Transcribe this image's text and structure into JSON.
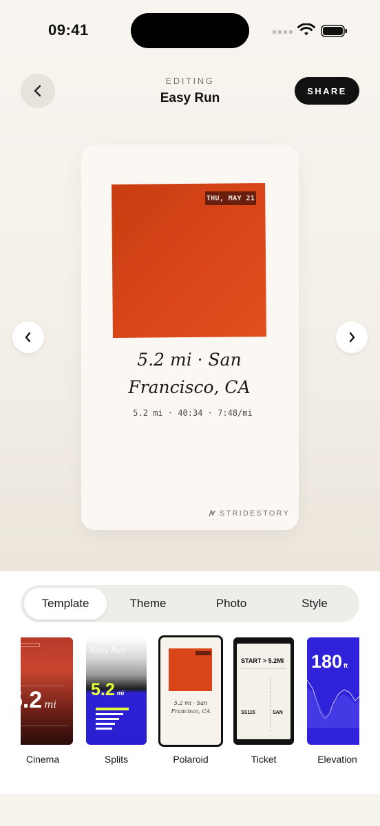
{
  "status": {
    "time": "09:41"
  },
  "header": {
    "label": "EDITING",
    "title": "Easy Run",
    "share_label": "SHARE"
  },
  "preview": {
    "date_badge": "THU, MAY 21",
    "caption": "5.2 mi · San Francisco, CA",
    "stats": "5.2 mi  ·  40:34  ·  7:48/mi",
    "brand": "STRIDESTORY",
    "photo_color": "#d9461a"
  },
  "tabs": [
    {
      "label": "Template",
      "active": true
    },
    {
      "label": "Theme",
      "active": false
    },
    {
      "label": "Photo",
      "active": false
    },
    {
      "label": "Style",
      "active": false
    }
  ],
  "templates": [
    {
      "label": "Cinema",
      "value": "5.2",
      "unit": "mi"
    },
    {
      "label": "Splits",
      "title": "Easy Run",
      "value": "5.2",
      "unit": "mi"
    },
    {
      "label": "Polaroid",
      "caption": "5.2 mi · San Francisco, CA",
      "selected": true
    },
    {
      "label": "Ticket",
      "route": "START > 5.2MI",
      "flight": "SS115",
      "seat": "SAN"
    },
    {
      "label": "Elevation",
      "value": "180",
      "unit": "ft"
    }
  ],
  "colors": {
    "accent": "#111111",
    "background": "#f6f2ec",
    "brand_orange": "#d9461a",
    "template_blue": "#2f22d8"
  }
}
